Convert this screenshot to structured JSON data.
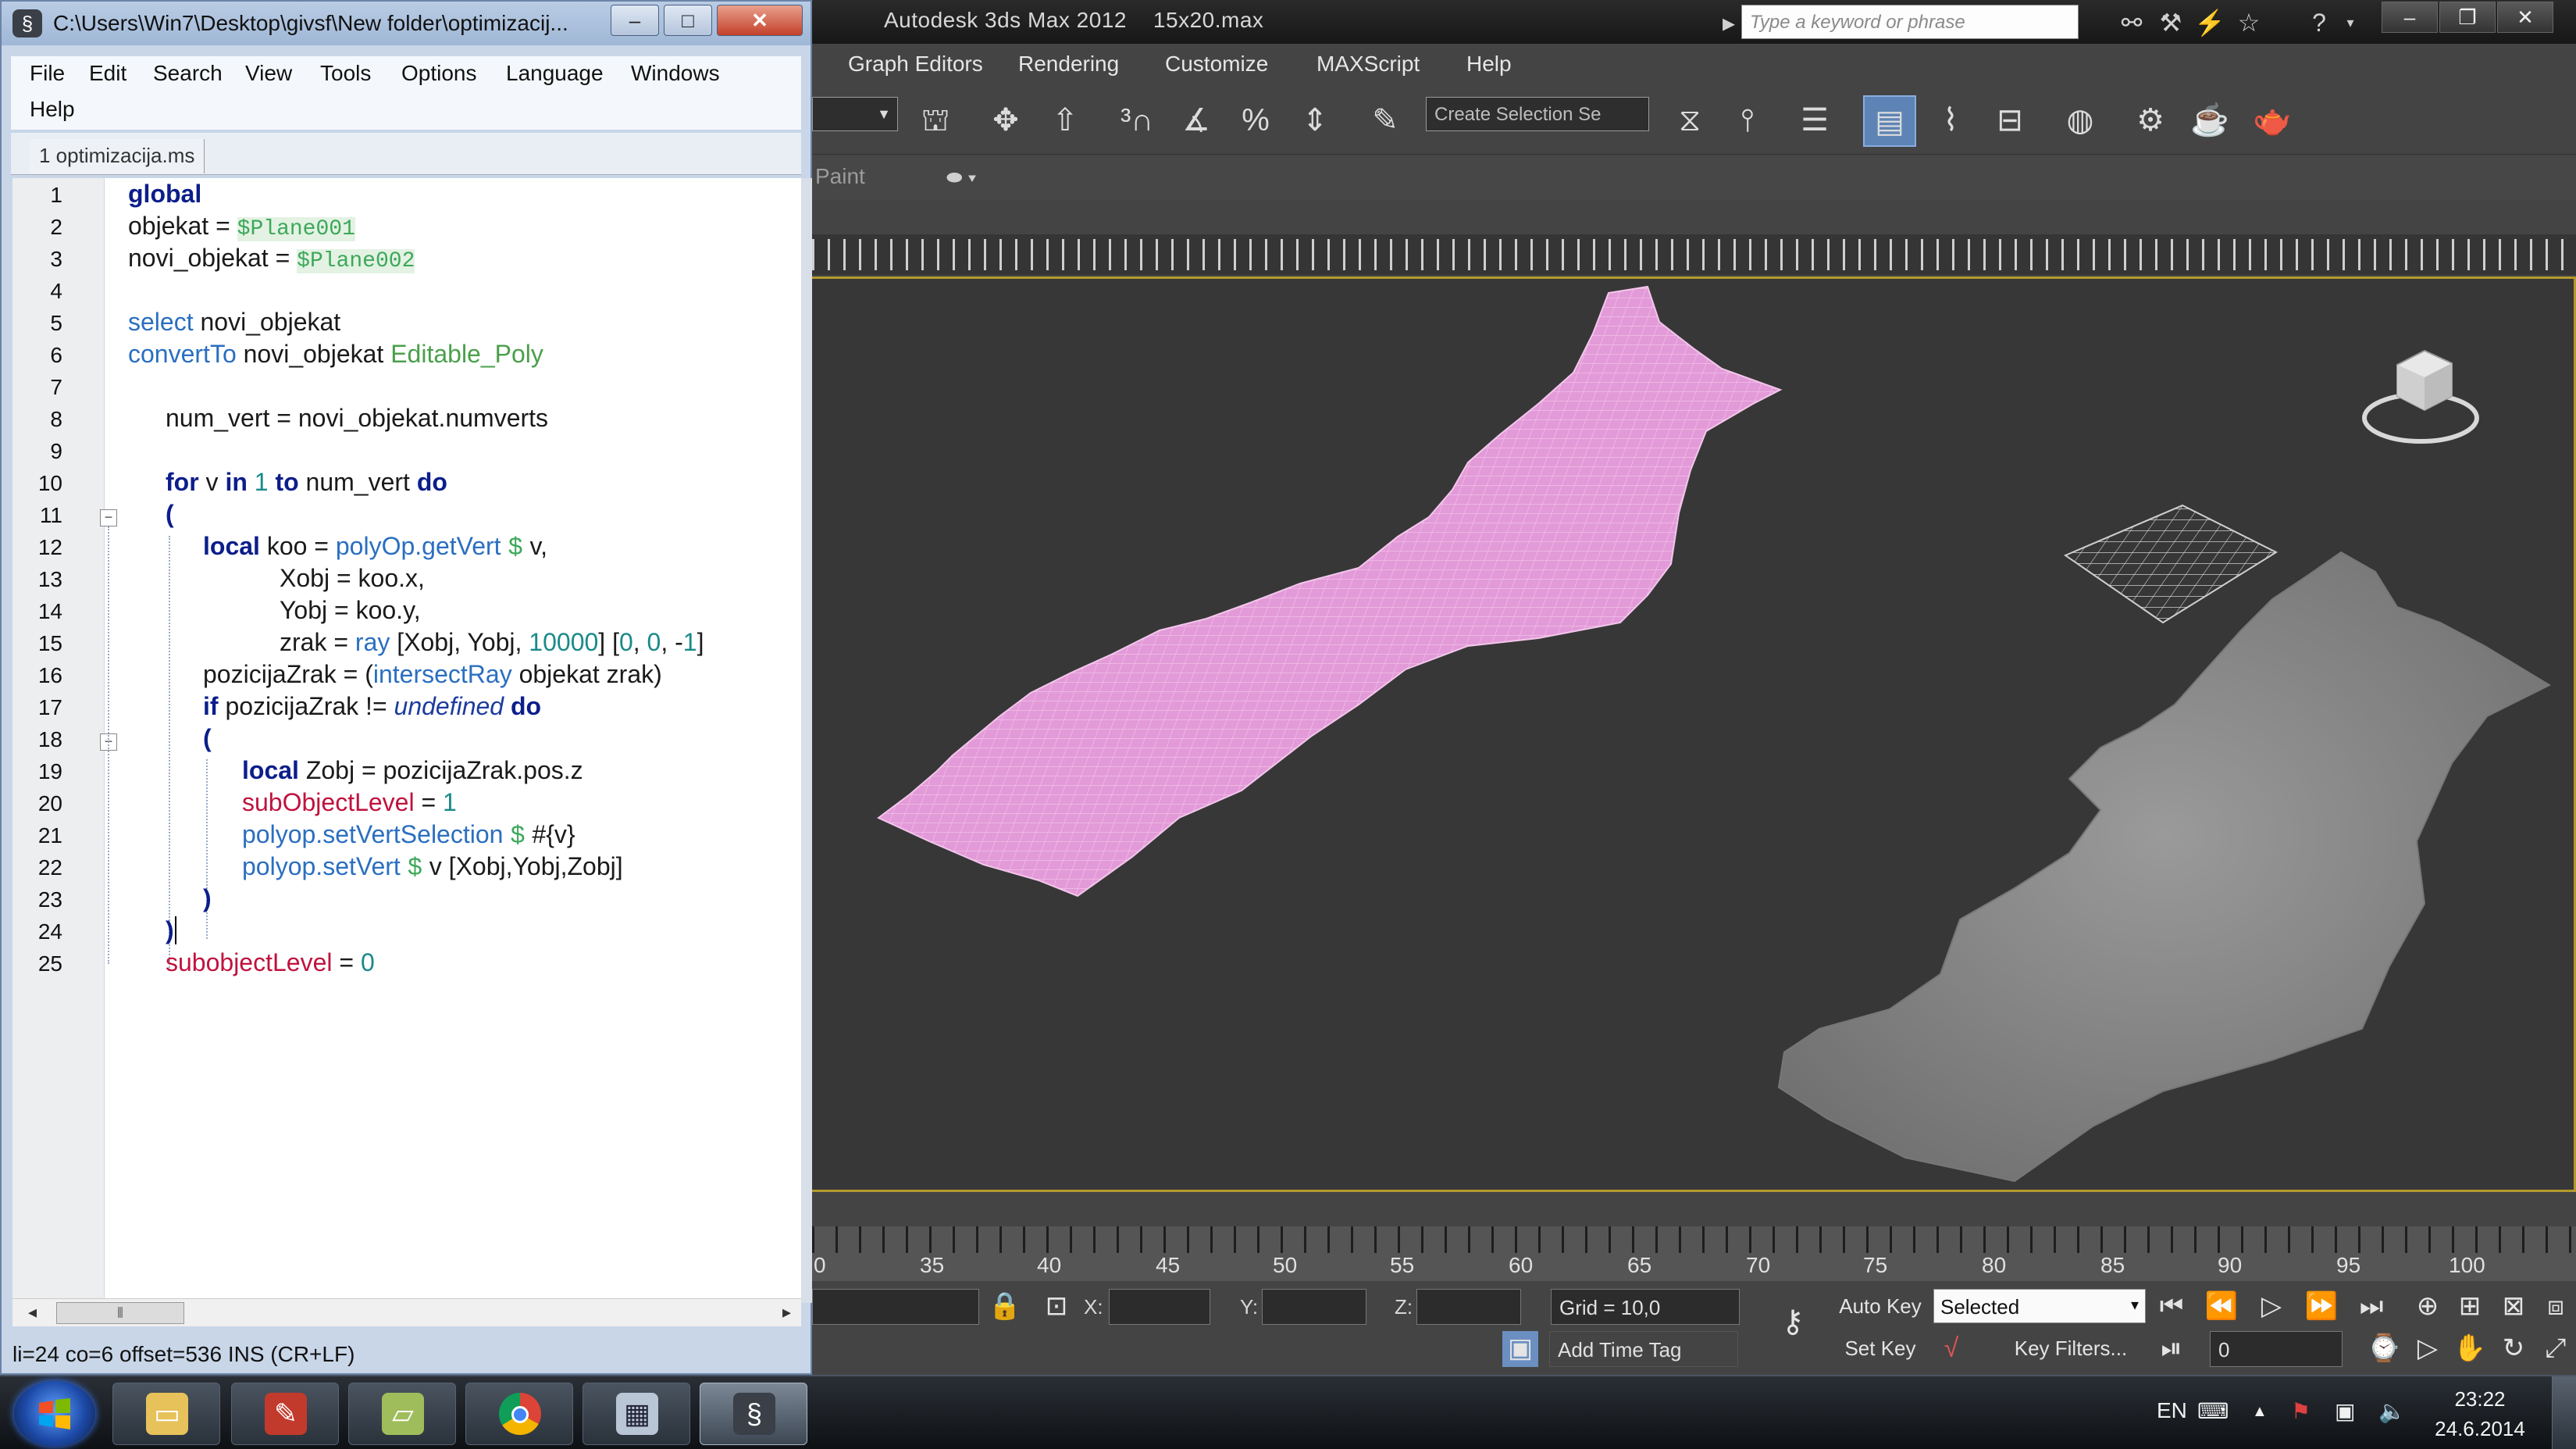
{
  "max": {
    "title": "Autodesk 3ds Max  2012",
    "file": "15x20.max",
    "search_placeholder": "Type a keyword or phrase",
    "menu": [
      "Graph Editors",
      "Rendering",
      "Customize",
      "MAXScript",
      "Help"
    ],
    "selection_set_placeholder": "Create Selection Se",
    "ribbon_label": "Paint",
    "timeline_numbers": [
      "0",
      "35",
      "40",
      "45",
      "50",
      "55",
      "60",
      "65",
      "70",
      "75",
      "80",
      "85",
      "90",
      "95",
      "100"
    ],
    "status": {
      "x_label": "X:",
      "y_label": "Y:",
      "z_label": "Z:",
      "grid": "Grid = 10,0",
      "auto_key": "Auto Key",
      "selected": "Selected",
      "set_key": "Set Key",
      "key_filters": "Key Filters...",
      "add_time_tag": "Add Time Tag",
      "frame": "0"
    },
    "colors": {
      "pink_mesh": "#e39ad8",
      "terrain": "#8a8a8a",
      "viewport_border": "#b39a2e"
    }
  },
  "editor": {
    "title": "C:\\Users\\Win7\\Desktop\\givsf\\New folder\\optimizacij...",
    "menu_row1": [
      "File",
      "Edit",
      "Search",
      "View",
      "Tools",
      "Options",
      "Language",
      "Windows"
    ],
    "menu_row2": [
      "Help"
    ],
    "tab": "1 optimizacija.ms",
    "line_numbers": [
      "1",
      "2",
      "3",
      "4",
      "5",
      "6",
      "7",
      "8",
      "9",
      "10",
      "11",
      "12",
      "13",
      "14",
      "15",
      "16",
      "17",
      "18",
      "19",
      "20",
      "21",
      "22",
      "23",
      "24",
      "25"
    ],
    "code": {
      "l1": "global",
      "l2_a": "objekat = ",
      "l2_b": "$Plane001",
      "l3_a": "novi_objekat = ",
      "l3_b": "$Plane002",
      "l5_a": "select",
      "l5_b": " novi_objekat",
      "l6_a": "convertTo",
      "l6_b": " novi_objekat ",
      "l6_c": "Editable_Poly",
      "l8": "num_vert = novi_objekat.numverts",
      "l10_a": "for",
      "l10_b": " v ",
      "l10_c": "in",
      "l10_d": " ",
      "l10_e": "1",
      "l10_f": " ",
      "l10_g": "to",
      "l10_h": " num_vert ",
      "l10_i": "do",
      "l11": "(",
      "l12_a": "local",
      "l12_b": " koo = ",
      "l12_c": "polyOp.getVert",
      "l12_d": " ",
      "l12_e": "$",
      "l12_f": " v,",
      "l13": "Xobj = koo.x,",
      "l14": "Yobj = koo.y,",
      "l15_a": "zrak = ",
      "l15_b": "ray",
      "l15_c": " [Xobj, Yobj, ",
      "l15_d": "10000",
      "l15_e": "] [",
      "l15_f": "0",
      "l15_g": ", ",
      "l15_h": "0",
      "l15_i": ", -",
      "l15_j": "1",
      "l15_k": "]",
      "l16_a": "pozicijaZrak = (",
      "l16_b": "intersectRay",
      "l16_c": " objekat zrak)",
      "l17_a": "if",
      "l17_b": " pozicijaZrak != ",
      "l17_c": "undefined",
      "l17_d": " ",
      "l17_e": "do",
      "l18": "(",
      "l19_a": "local",
      "l19_b": " Zobj = pozicijaZrak.pos.z",
      "l20_a": "subObjectLevel",
      "l20_b": " = ",
      "l20_c": "1",
      "l21_a": "polyop.setVertSelection",
      "l21_b": " ",
      "l21_c": "$",
      "l21_d": " #{v}",
      "l22_a": "polyop.setVert",
      "l22_b": " ",
      "l22_c": "$",
      "l22_d": " v [Xobj,Yobj,Zobj]",
      "l23": ")",
      "l24": ")",
      "l25_a": "subobjectLevel",
      "l25_b": " = ",
      "l25_c": "0"
    },
    "status": "li=24 co=6 offset=536 INS (CR+LF)"
  },
  "taskbar": {
    "lang": "EN",
    "time": "23:22",
    "date": "24.6.2014"
  }
}
